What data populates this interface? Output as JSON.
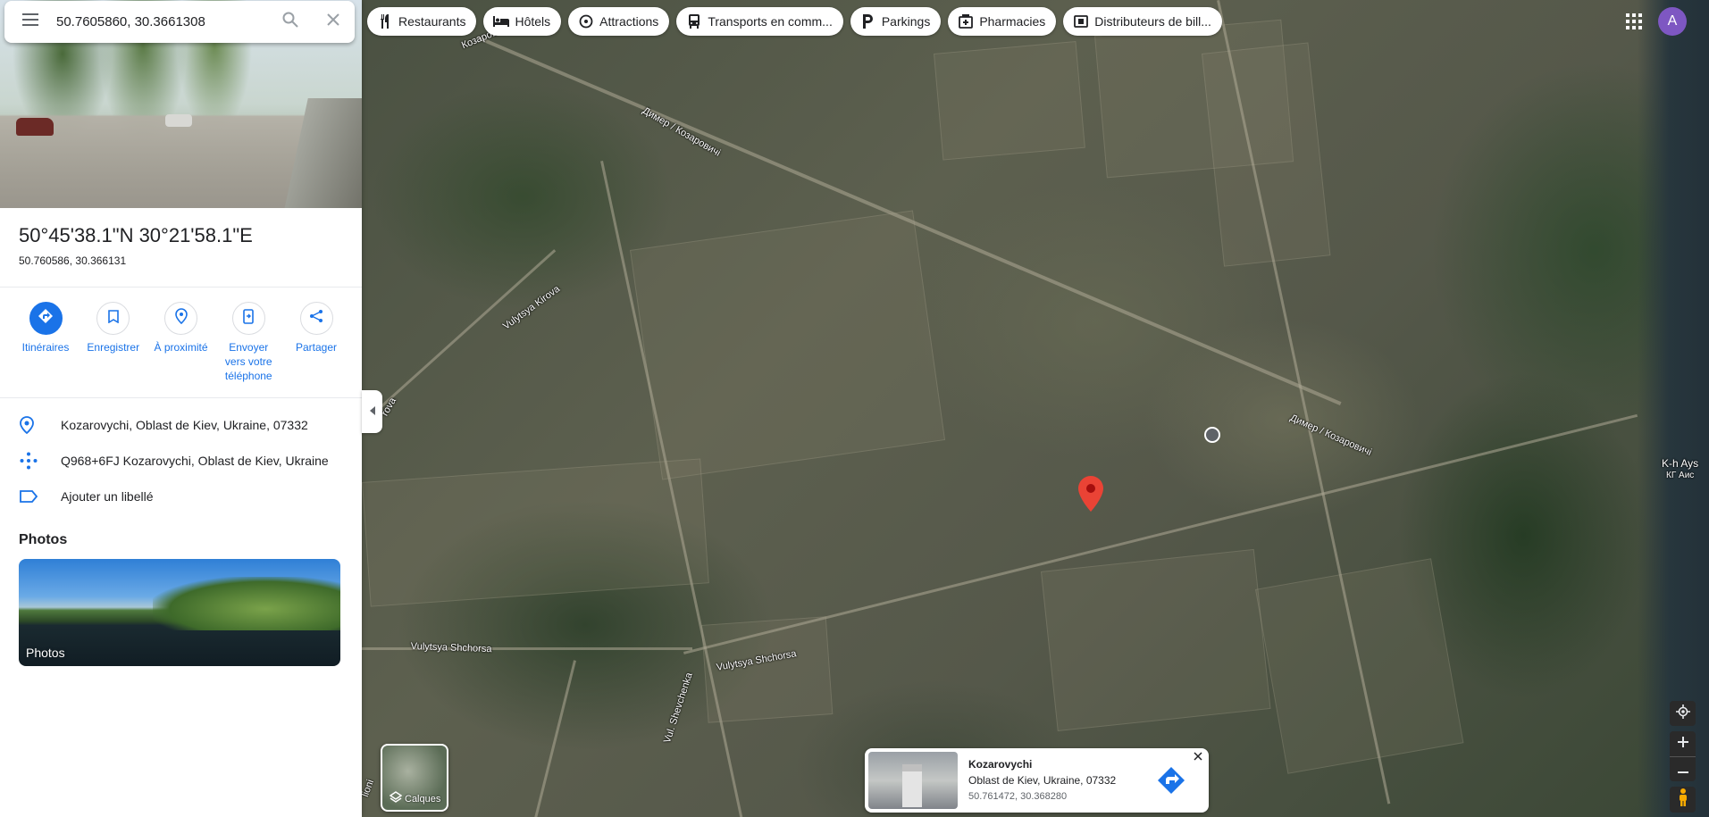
{
  "search": {
    "query": "50.7605860, 30.3661308"
  },
  "place": {
    "title": "50°45'38.1\"N 30°21'58.1\"E",
    "subtitle": "50.760586, 30.366131"
  },
  "actions": [
    {
      "label": "Itinéraires"
    },
    {
      "label": "Enregistrer"
    },
    {
      "label": "À proximité"
    },
    {
      "label": "Envoyer vers votre téléphone"
    },
    {
      "label": "Partager"
    }
  ],
  "info": {
    "address": "Kozarovychi, Oblast de Kiev, Ukraine, 07332",
    "pluscode": "Q968+6FJ Kozarovychi, Oblast de Kiev, Ukraine",
    "label": "Ajouter un libellé"
  },
  "photos": {
    "heading": "Photos",
    "card_caption": "Photos"
  },
  "chips": [
    {
      "label": "Restaurants",
      "icon": "fork-knife-icon"
    },
    {
      "label": "Hôtels",
      "icon": "bed-icon"
    },
    {
      "label": "Attractions",
      "icon": "attraction-icon"
    },
    {
      "label": "Transports en comm...",
      "icon": "bus-icon"
    },
    {
      "label": "Parkings",
      "icon": "parking-icon"
    },
    {
      "label": "Pharmacies",
      "icon": "pharmacy-icon"
    },
    {
      "label": "Distributeurs de bill...",
      "icon": "atm-icon"
    }
  ],
  "user": {
    "initial": "A",
    "avatar_color": "#7e57c2"
  },
  "map_labels": {
    "road1": "Димер / Козаровичі",
    "road1b": "Козаровичі",
    "road2": "Димер / Козаровичі",
    "kirova": "Vulytsya Kirova",
    "shchorsa1": "Vulytsya Shchorsa",
    "shchorsa2": "Vulytsya Shchorsa",
    "shevchenka": "Vul. Shevchenka",
    "rova": "rova",
    "kh1": "K-h Ays",
    "kh2": "КГ Аис",
    "lioni": "lioni"
  },
  "layers": {
    "label": "Calques"
  },
  "card": {
    "name": "Kozarovychi",
    "line": "Oblast de Kiev, Ukraine, 07332",
    "coords": "50.761472, 30.368280"
  },
  "colors": {
    "accent": "#1a73e8",
    "pin": "#ea4335"
  }
}
